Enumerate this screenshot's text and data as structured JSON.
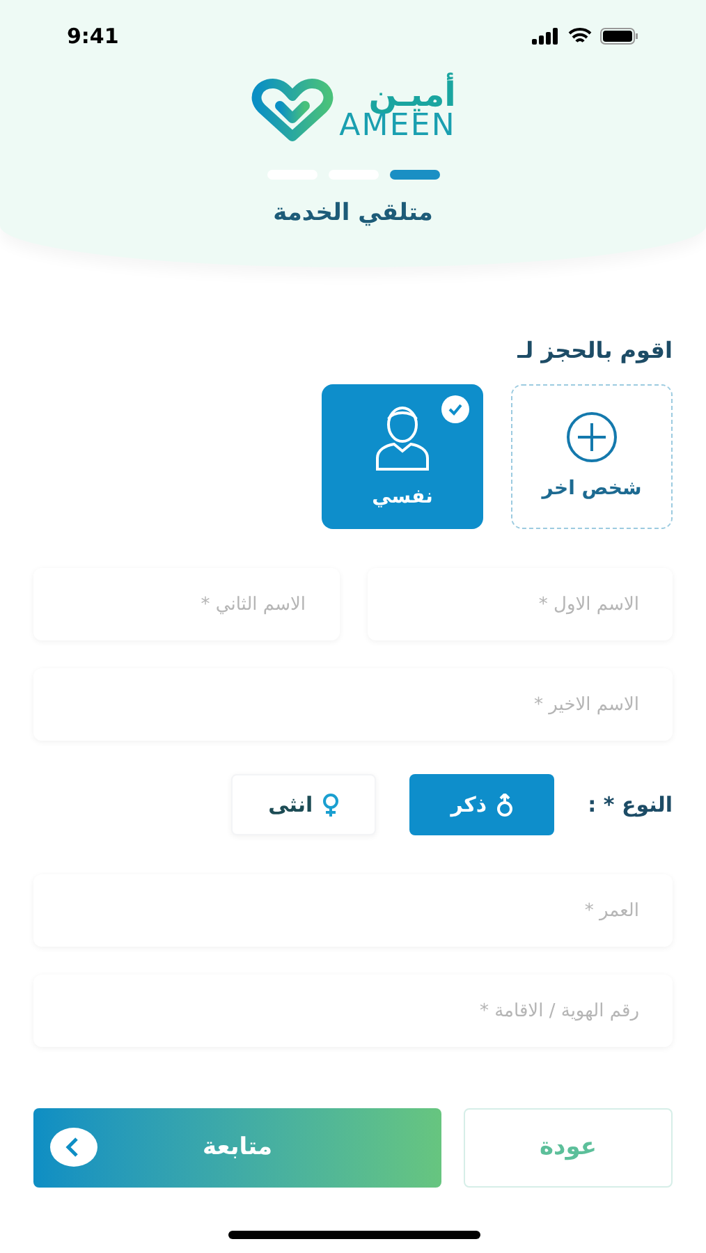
{
  "status_bar": {
    "time": "9:41"
  },
  "logo": {
    "arabic": "أميـن",
    "latin": "AMEEN"
  },
  "steps": [
    {
      "selected": false
    },
    {
      "selected": false
    },
    {
      "selected": true
    }
  ],
  "title": "متلقي الخدمة",
  "booking_label": "اقوم بالحجز لـ",
  "booking_options": [
    {
      "kind": "add",
      "label": "شخص اخر",
      "selected": false
    },
    {
      "kind": "person",
      "label": "نفسي",
      "selected": true
    }
  ],
  "fields_row": [
    {
      "placeholder": "الاسم الاول *"
    },
    {
      "placeholder": "الاسم الثاني *"
    }
  ],
  "last_name": {
    "placeholder": "الاسم الاخير *"
  },
  "gender": {
    "label": "النوع * :",
    "options": [
      {
        "kind": "male",
        "label": "ذكر",
        "selected": true
      },
      {
        "kind": "female",
        "label": "انثى",
        "selected": false
      }
    ]
  },
  "age": {
    "placeholder": "العمر *"
  },
  "id_number": {
    "placeholder": "رقم الهوية / الاقامة *"
  },
  "buttons": {
    "back": "عودة",
    "next": "متابعة"
  }
}
